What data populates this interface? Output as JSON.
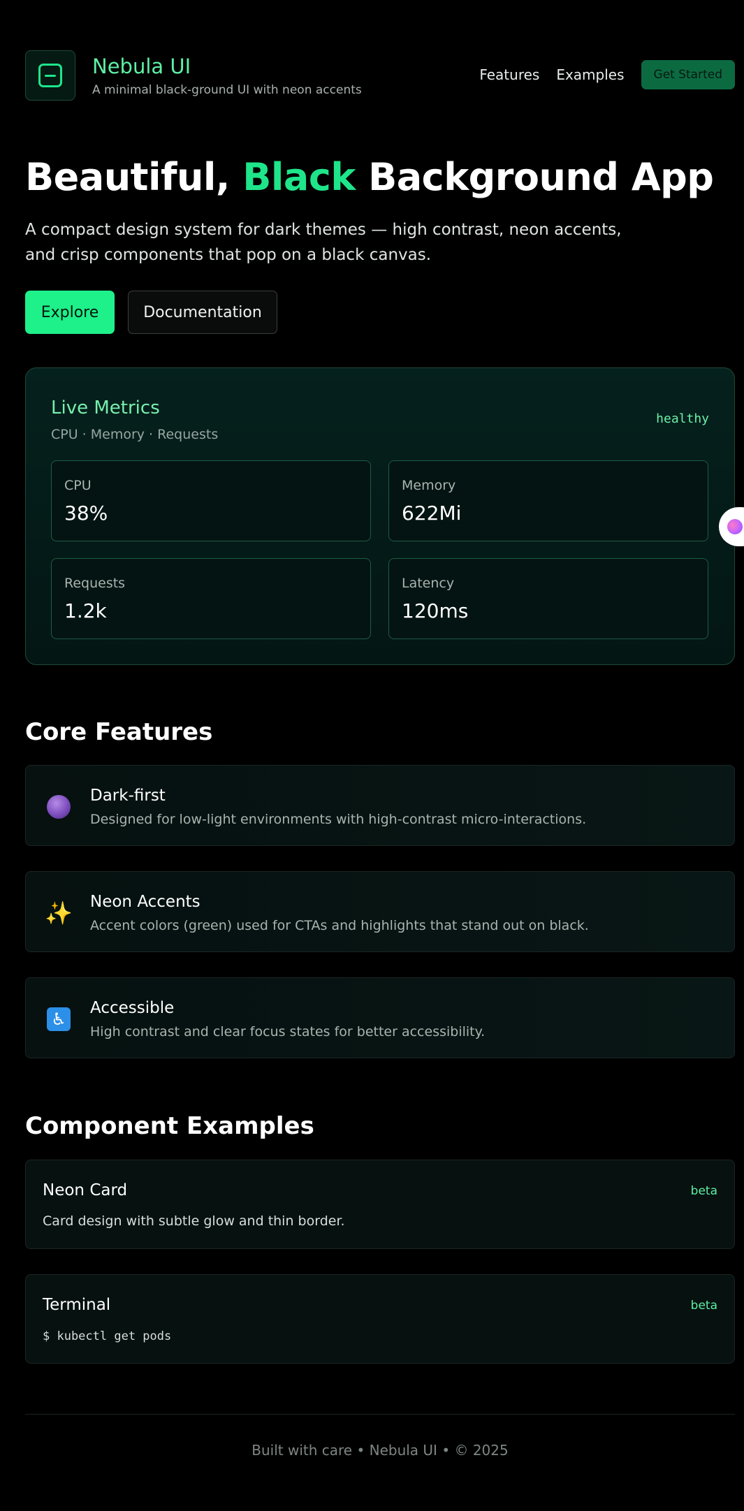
{
  "header": {
    "brand_name": "Nebula UI",
    "brand_tagline": "A minimal black-ground UI with neon accents",
    "nav_features": "Features",
    "nav_examples": "Examples",
    "cta": "Get Started"
  },
  "hero": {
    "title_part1": "Beautiful, ",
    "title_accent": "Black",
    "title_part2": " Background App",
    "subtitle": "A compact design system for dark themes — high contrast, neon accents, and crisp components that pop on a black canvas.",
    "primary_button": "Explore",
    "secondary_button": "Documentation"
  },
  "metrics": {
    "title": "Live Metrics",
    "subtitle": "CPU · Memory · Requests",
    "status": "healthy",
    "cards": [
      {
        "label": "CPU",
        "value": "38%"
      },
      {
        "label": "Memory",
        "value": "622Mi"
      },
      {
        "label": "Requests",
        "value": "1.2k"
      },
      {
        "label": "Latency",
        "value": "120ms"
      }
    ]
  },
  "features": {
    "heading": "Core Features",
    "items": [
      {
        "icon": "planet-icon",
        "title": "Dark-first",
        "desc": "Designed for low-light environments with high-contrast micro-interactions."
      },
      {
        "icon": "sparkles-icon",
        "title": "Neon Accents",
        "desc": "Accent colors (green) used for CTAs and highlights that stand out on black."
      },
      {
        "icon": "accessibility-icon",
        "title": "Accessible",
        "desc": "High contrast and clear focus states for better accessibility."
      }
    ]
  },
  "components": {
    "heading": "Component Examples",
    "items": [
      {
        "title": "Neon Card",
        "badge": "beta",
        "desc": "Card design with subtle glow and thin border."
      },
      {
        "title": "Terminal",
        "badge": "beta",
        "desc": "$ kubectl get pods"
      }
    ]
  },
  "footer": {
    "text": "Built with care • Nebula UI • © 2025"
  },
  "colors": {
    "background": "#000000",
    "accent": "#1ee58a",
    "accent_soft": "#5ef0a4"
  }
}
